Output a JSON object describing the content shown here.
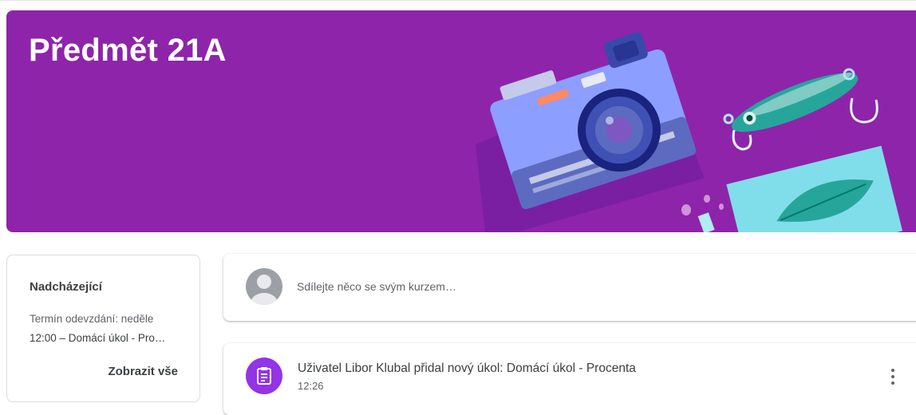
{
  "course": {
    "title": "Předmět 21A",
    "banner_color": "#8e24aa"
  },
  "upcoming": {
    "title": "Nadcházející",
    "due_label": "Termín odevzdání: neděle",
    "item": "12:00 – Domácí úkol - Pro…",
    "view_all": "Zobrazit vše"
  },
  "share": {
    "placeholder": "Sdílejte něco se svým kurzem…",
    "avatar_icon": "default-avatar-icon"
  },
  "stream": {
    "posts": [
      {
        "icon": "assignment-icon",
        "icon_color": "#9334e6",
        "title": "Uživatel Libor Klubal přidal nový úkol: Domácí úkol - Procenta",
        "time": "12:26"
      }
    ]
  }
}
